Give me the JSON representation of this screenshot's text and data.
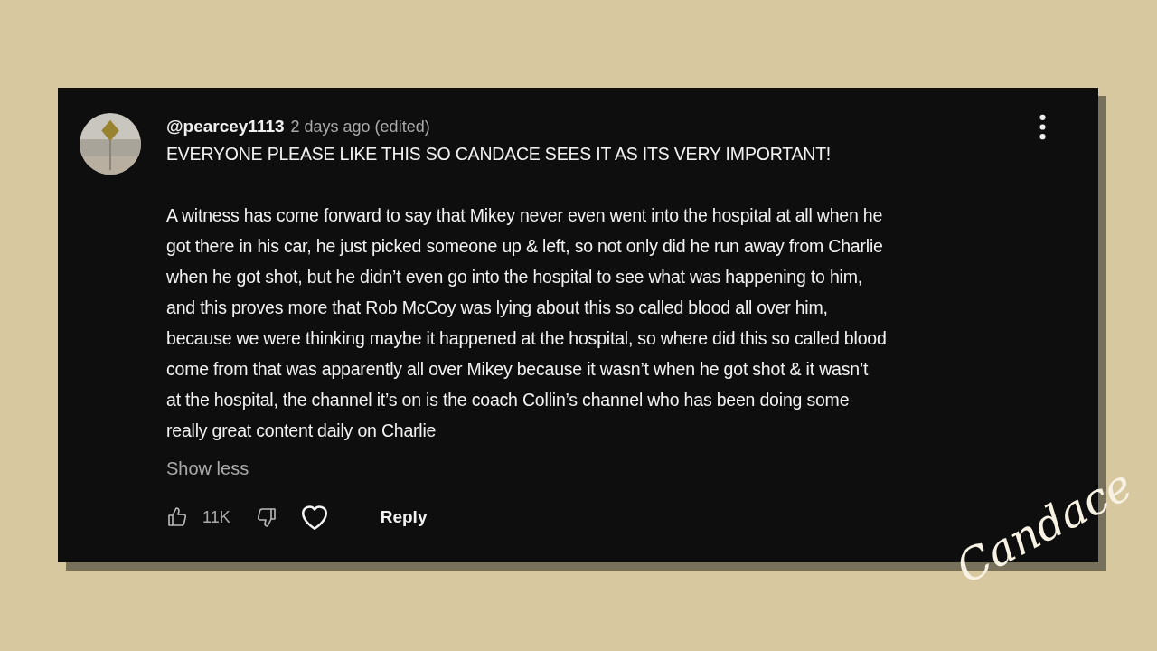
{
  "comment": {
    "author": "@pearcey1113",
    "time": "2 days ago (edited)",
    "paragraphs": [
      [
        "EVERYONE PLEASE LIKE THIS SO CANDACE SEES IT AS ITS VERY IMPORTANT!"
      ],
      [
        "A witness has come forward to say that Mikey never even went into the hospital at all when he",
        "got there in his car, he just picked someone up & left, so not only did he run away from Charlie",
        "when he got shot, but he didn’t even go into the hospital to see what was happening to him,",
        "and this proves more that Rob McCoy was lying about this so called blood all over him,",
        "because we were thinking maybe it happened at the hospital, so where did this so called blood",
        "come from that was apparently all over Mikey because it wasn’t when he got shot & it wasn’t",
        "at the hospital, the channel it’s on is the coach Collin’s channel who has been doing some",
        "really great content daily on Charlie"
      ]
    ],
    "show_less": "Show less",
    "likes": "11K",
    "liked": false,
    "disliked": false,
    "hearted": false,
    "reply": "Reply"
  },
  "logo_text": "Candace"
}
